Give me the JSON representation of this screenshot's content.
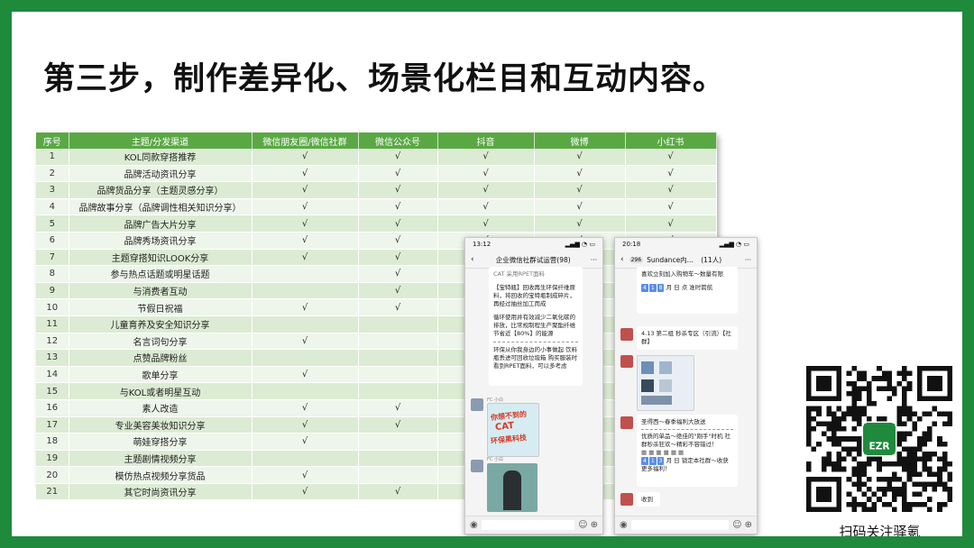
{
  "title": "第三步，制作差异化、场景化栏目和互动内容。",
  "table": {
    "headers": [
      "序号",
      "主题/分发渠道",
      "微信朋友圈/微信社群",
      "微信公众号",
      "抖音",
      "微博",
      "小红书"
    ],
    "check": "√",
    "rows": [
      {
        "n": "1",
        "topic": "KOL同款穿搭推荐",
        "c": [
          1,
          1,
          1,
          1,
          1
        ]
      },
      {
        "n": "2",
        "topic": "品牌活动资讯分享",
        "c": [
          1,
          1,
          1,
          1,
          1
        ]
      },
      {
        "n": "3",
        "topic": "品牌货品分享（主题灵感分享）",
        "c": [
          1,
          1,
          1,
          1,
          1
        ]
      },
      {
        "n": "4",
        "topic": "品牌故事分享（品牌调性相关知识分享）",
        "c": [
          1,
          1,
          1,
          1,
          1
        ]
      },
      {
        "n": "5",
        "topic": "品牌广告大片分享",
        "c": [
          1,
          1,
          1,
          1,
          1
        ]
      },
      {
        "n": "6",
        "topic": "品牌秀场资讯分享",
        "c": [
          1,
          1,
          1,
          1,
          1
        ]
      },
      {
        "n": "7",
        "topic": "主题穿搭知识LOOK分享",
        "c": [
          1,
          1,
          0,
          0,
          0
        ]
      },
      {
        "n": "8",
        "topic": "参与热点话题或明星话题",
        "c": [
          0,
          1,
          0,
          0,
          0
        ]
      },
      {
        "n": "9",
        "topic": "与消费者互动",
        "c": [
          0,
          1,
          0,
          0,
          0
        ]
      },
      {
        "n": "10",
        "topic": "节假日祝福",
        "c": [
          1,
          1,
          0,
          0,
          0
        ]
      },
      {
        "n": "11",
        "topic": "儿童育养及安全知识分享",
        "c": [
          0,
          0,
          0,
          0,
          0
        ]
      },
      {
        "n": "12",
        "topic": "名言词句分享",
        "c": [
          1,
          0,
          0,
          0,
          0
        ]
      },
      {
        "n": "13",
        "topic": "点赞品牌粉丝",
        "c": [
          0,
          0,
          0,
          0,
          0
        ]
      },
      {
        "n": "14",
        "topic": "歌单分享",
        "c": [
          1,
          0,
          0,
          0,
          0
        ]
      },
      {
        "n": "15",
        "topic": "与KOL或者明星互动",
        "c": [
          0,
          0,
          0,
          0,
          0
        ]
      },
      {
        "n": "16",
        "topic": "素人改造",
        "c": [
          1,
          1,
          0,
          0,
          0
        ]
      },
      {
        "n": "17",
        "topic": "专业美容美妆知识分享",
        "c": [
          1,
          1,
          0,
          0,
          0
        ]
      },
      {
        "n": "18",
        "topic": "萌娃穿搭分享",
        "c": [
          1,
          0,
          0,
          0,
          0
        ]
      },
      {
        "n": "19",
        "topic": "主题剧情视频分享",
        "c": [
          0,
          0,
          0,
          0,
          0
        ]
      },
      {
        "n": "20",
        "topic": "模仿热点视频分享货品",
        "c": [
          1,
          0,
          0,
          0,
          0
        ]
      },
      {
        "n": "21",
        "topic": "其它时尚资讯分享",
        "c": [
          1,
          1,
          0,
          0,
          0
        ]
      }
    ]
  },
  "phone1": {
    "time": "13:12",
    "chat_title": "企业微信社群试运营(98)",
    "msg1_top": "CAT 采用RPET面料",
    "msg1_body1": "【宝特瓶】回收再生环保纤维原料，将回收的宝特瓶制成碎片，再经过抽丝加工而成",
    "msg1_body2": "循环使用并有效减少二氧化碳的排放，比常规制程生产聚酯纤维节省近【80%】的能源",
    "msg1_body3": "环保从你我身边的小事做起 饮料瓶丢进可回收垃圾箱 购买服装时看到RPET面料，可以多考虑",
    "sender": "FC 小白",
    "card_line1": "你想不到的",
    "card_line2": "CAT",
    "card_line3": "环保黑科技"
  },
  "phone2": {
    "time": "20:18",
    "badge": "296",
    "chat_title": "Sundance内...",
    "members": "(11人)",
    "msg1": "喜欢立刻加入购物车～数量有限",
    "msg1_date": "月 日 点 准时箭航",
    "msg2": "4.13 第二组  秒杀专区（引流）【社群】",
    "msg3_title": "圣得西～春季福利大放送",
    "msg3_body": "优质的单品～绝佳的\"刚手\"时机 社群秒杀狂欢～精彩不容错过！",
    "msg3_date": "月 日 锁定本社群～收获更多福利！",
    "msg4": "收到"
  },
  "qr": {
    "logo_text": "EZR",
    "caption": "扫码关注驿氪"
  }
}
